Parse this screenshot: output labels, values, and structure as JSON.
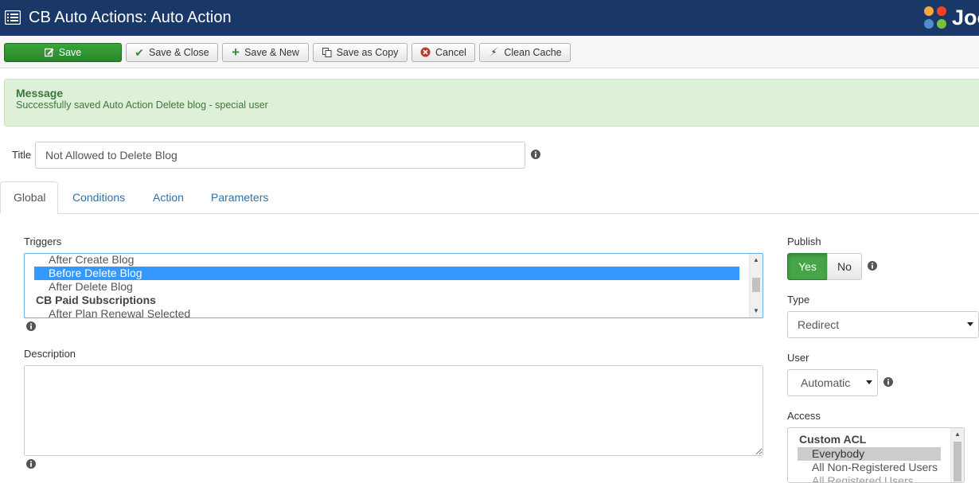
{
  "header": {
    "title": "CB Auto Actions: Auto Action",
    "logo_text": "Joomla!"
  },
  "toolbar": {
    "save": "Save",
    "save_close": "Save & Close",
    "save_new": "Save & New",
    "save_copy": "Save as Copy",
    "cancel": "Cancel",
    "clean_cache": "Clean Cache"
  },
  "message": {
    "heading": "Message",
    "text": "Successfully saved Auto Action Delete blog - special user"
  },
  "title_field": {
    "label": "Title",
    "value": "Not Allowed to Delete Blog"
  },
  "tabs": [
    "Global",
    "Conditions",
    "Action",
    "Parameters"
  ],
  "triggers": {
    "label": "Triggers",
    "options": [
      "After Create Blog",
      "Before Delete Blog",
      "After Delete Blog"
    ],
    "selected": "Before Delete Blog",
    "group": "CB Paid Subscriptions",
    "group_options": [
      "After Plan Renewal Selected"
    ]
  },
  "description": {
    "label": "Description",
    "value": ""
  },
  "publish": {
    "label": "Publish",
    "yes": "Yes",
    "no": "No",
    "value": "Yes"
  },
  "type": {
    "label": "Type",
    "value": "Redirect"
  },
  "user": {
    "label": "User",
    "value": "Automatic"
  },
  "access": {
    "label": "Access",
    "group": "Custom ACL",
    "options": [
      "Everybody",
      "All Non-Registered Users",
      "All Registered Users"
    ],
    "selected": "Everybody"
  },
  "colors": {
    "header_bg": "#1a3867",
    "save_green": "#2f962f",
    "message_bg": "#dff0d8",
    "message_text": "#3c763d",
    "link_blue": "#3071a9",
    "selected_option": "#3399ff"
  }
}
